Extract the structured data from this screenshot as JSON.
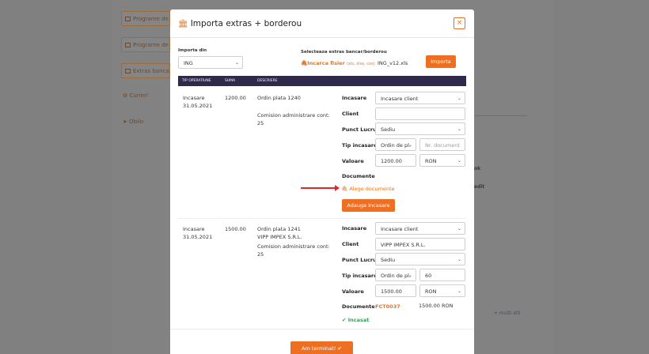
{
  "background": {
    "buttons": [
      "Programe de f",
      "Programe de d",
      "Extras banca"
    ],
    "links": [
      "Curieri",
      "Obilo"
    ],
    "texts": [
      "ok",
      "edit",
      "+ multi alti"
    ]
  },
  "modal": {
    "title": "Importa extras + borderou",
    "close_label": "×",
    "import_from_label": "Importa din",
    "import_from_value": "ING",
    "select_file_label": "Selecteaza extras bancar/borderou",
    "upload_link": "Incarca fisier",
    "upload_ext": "(xls, xlsx, csv)",
    "filename": "ING_v12.xls",
    "import_button": "Importa",
    "table_headers": [
      "TIP OPERATIUNE",
      "SUMA",
      "DESCRIERE"
    ],
    "rows": [
      {
        "type": "Incasare",
        "date": "31.05.2021",
        "amount": "1200.00",
        "desc1": "Ordin plata 1240",
        "desc2": "Comision administrare cont:",
        "desc3": "25",
        "incasare_label": "Incasare",
        "incasare_value": "Incasare client",
        "client_label": "Client",
        "client_value": "",
        "punct_label": "Punct Lucru",
        "punct_value": "Sediu",
        "tip_label": "Tip incasare",
        "tip_value": "Ordin de pl.",
        "nr_placeholder": "Nr. document",
        "valoare_label": "Valoare",
        "valoare_value": "1200.00",
        "currency": "RON",
        "documente_label": "Documente",
        "alege_link": "Alege documente",
        "adauga_button": "Adauga Incasare"
      },
      {
        "type": "Incasare",
        "date": "31.05.2021",
        "amount": "1500.00",
        "desc1": "Ordin plata 1241",
        "desc2": "VIPP IMPEX S.R.L.",
        "desc3": "Comision administrare cont:",
        "desc4": "25",
        "incasare_label": "Incasare",
        "incasare_value": "Incasare client",
        "client_label": "Client",
        "client_value": "VIPP IMPEX S.R.L.",
        "punct_label": "Punct Lucru",
        "punct_value": "Sediu",
        "tip_label": "Tip incasare",
        "tip_value": "Ordin de pl.",
        "nr_value": "60",
        "valoare_label": "Valoare",
        "valoare_value": "1500.00",
        "currency": "RON",
        "documente_label": "Documente",
        "doc_number": "FCT0037",
        "doc_amount": "1500.00 RON",
        "status": "Incasat"
      }
    ],
    "finish_button": "Am terminat!"
  },
  "colors": {
    "accent": "#ef6f22",
    "header": "#2f2a4a",
    "success": "#2ea44f",
    "arrow": "#e32626"
  }
}
